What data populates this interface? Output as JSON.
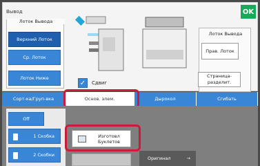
{
  "screen": {
    "title": "Вывод",
    "ok_label": "OK"
  },
  "tray_left": {
    "title": "Лоток Вывода",
    "buttons": [
      "Верхний Лоток",
      "Ср. Лоток",
      "Лоток Ниже"
    ]
  },
  "tray_right": {
    "title": "Лоток Вывода",
    "buttons": [
      "Прав. Лоток",
      "Страница-разделит."
    ]
  },
  "shift": {
    "label": "Сдвиг"
  },
  "tabs": [
    "Сорт-ка/Груп-вка",
    "Основ. элем.",
    "Дырокол",
    "Сгибать"
  ],
  "lower": {
    "off_label": "Off",
    "staples": [
      "1 Скобка",
      "2 Скобки"
    ],
    "booklet_label": "Изготовл Буклетов",
    "original_label": "Оригинал"
  },
  "colors": {
    "accent": "#3a86d6",
    "ok": "#19a95b",
    "highlight": "#cc1a3a"
  }
}
